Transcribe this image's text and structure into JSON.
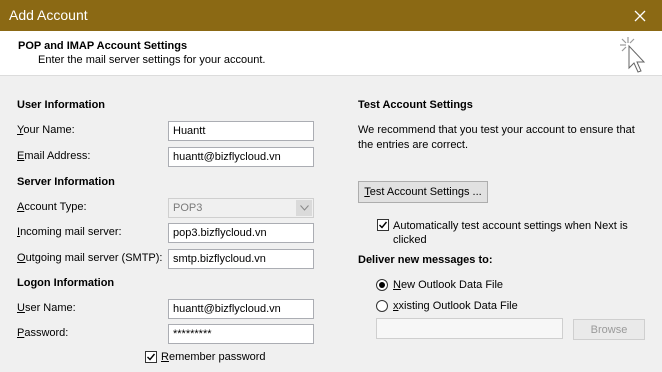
{
  "window": {
    "title": "Add Account"
  },
  "header": {
    "title": "POP and IMAP Account Settings",
    "subtitle": "Enter the mail server settings for your account."
  },
  "user_information": {
    "heading": "User Information",
    "your_name_label_rest": "our Name:",
    "your_name_value": "Huantt",
    "email_label_rest": "mail Address:",
    "email_value": "huantt@bizflycloud.vn"
  },
  "server_information": {
    "heading": "Server Information",
    "account_type_label_rest": "ccount Type:",
    "account_type_value": "POP3",
    "incoming_label_rest": "ncoming mail server:",
    "incoming_value": "pop3.bizflycloud.vn",
    "outgoing_label_rest": "utgoing mail server (SMTP):",
    "outgoing_value": "smtp.bizflycloud.vn"
  },
  "logon_information": {
    "heading": "Logon Information",
    "username_label_rest": "ser Name:",
    "username_value": "huantt@bizflycloud.vn",
    "password_label_rest": "assword:",
    "password_value": "*********",
    "remember_label_rest": "emember password"
  },
  "test_settings": {
    "heading": "Test Account Settings",
    "description": "We recommend that you test your account to ensure that the entries are correct.",
    "test_button_rest": "est Account Settings ...",
    "auto_test_label": "Automatically test account settings when Next is clicked"
  },
  "deliver": {
    "heading": "Deliver new messages to:",
    "new_label_rest": "ew Outlook Data File",
    "existing_label_rest": "xisting Outlook Data File",
    "existing_path_value": "",
    "browse_label": "Browse"
  },
  "colors": {
    "title_bar": "#8b6914",
    "dialog_bg": "#f0f0f0"
  }
}
